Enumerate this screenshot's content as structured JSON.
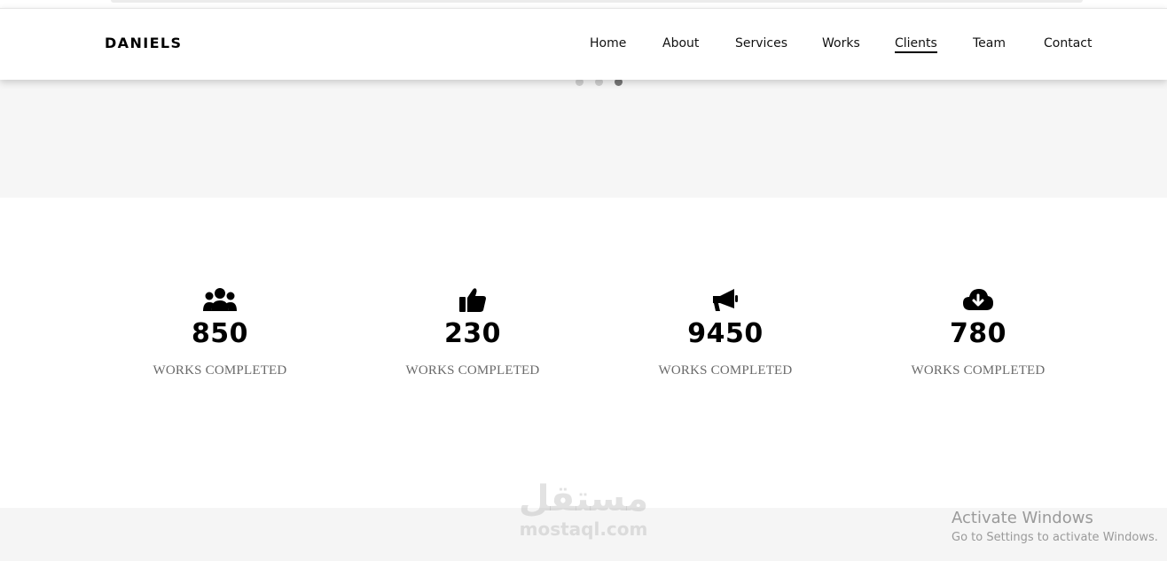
{
  "brand": "DANIELS",
  "nav": {
    "items": [
      {
        "label": "Home"
      },
      {
        "label": "About"
      },
      {
        "label": "Services"
      },
      {
        "label": "Works"
      },
      {
        "label": "Clients"
      },
      {
        "label": "Team"
      },
      {
        "label": "Contact"
      }
    ],
    "active_item": "Clients"
  },
  "slider": {
    "dots": 3,
    "active_dot": 3
  },
  "stats": [
    {
      "icon": "users-icon",
      "value": "850",
      "label": "WORKS COMPLETED"
    },
    {
      "icon": "thumbs-up-icon",
      "value": "230",
      "label": "WORKS COMPLETED"
    },
    {
      "icon": "megaphone-icon",
      "value": "9450",
      "label": "WORKS COMPLETED"
    },
    {
      "icon": "cloud-download-icon",
      "value": "780",
      "label": "WORKS COMPLETED"
    }
  ],
  "watermark": {
    "arabic": "مستقل",
    "latin": "mostaql.com"
  },
  "os_notice": {
    "title": "Activate Windows",
    "subtitle": "Go to Settings to activate Windows."
  },
  "colors": {
    "accent": "#000000",
    "muted_text": "#6a6a6a",
    "band": "#f6f6f6"
  }
}
